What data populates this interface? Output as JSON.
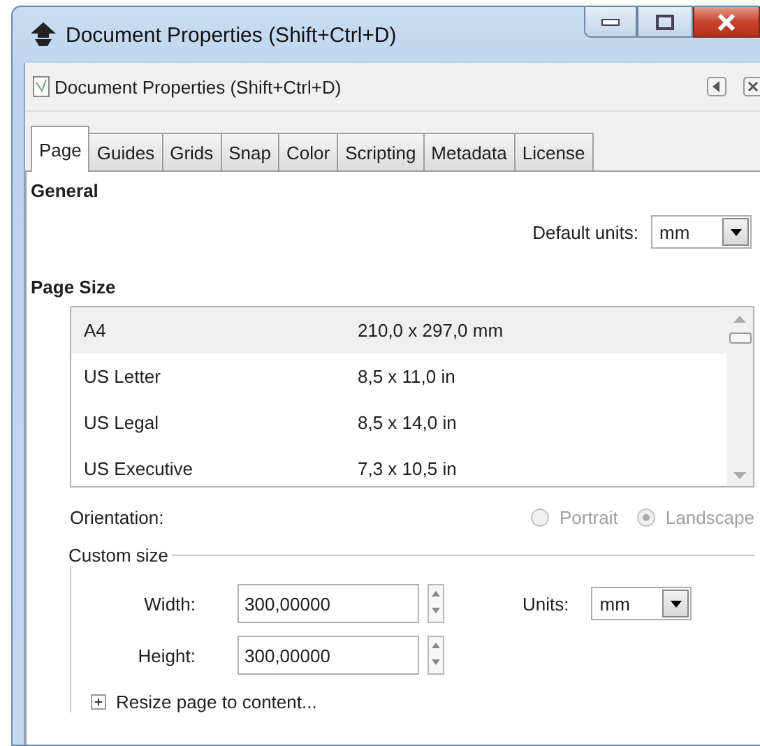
{
  "window": {
    "title": "Document Properties (Shift+Ctrl+D)"
  },
  "panel": {
    "title": "Document Properties (Shift+Ctrl+D)"
  },
  "tabs": [
    {
      "label": "Page",
      "selected": true
    },
    {
      "label": "Guides",
      "selected": false
    },
    {
      "label": "Grids",
      "selected": false
    },
    {
      "label": "Snap",
      "selected": false
    },
    {
      "label": "Color",
      "selected": false
    },
    {
      "label": "Scripting",
      "selected": false
    },
    {
      "label": "Metadata",
      "selected": false
    },
    {
      "label": "License",
      "selected": false
    }
  ],
  "general": {
    "heading": "General",
    "default_units": {
      "label": "Default units:",
      "value": "mm"
    }
  },
  "page_size": {
    "heading": "Page Size",
    "rows": [
      {
        "name": "A4",
        "size": "210,0 x 297,0 mm",
        "selected": true
      },
      {
        "name": "US Letter",
        "size": "8,5 x 11,0 in",
        "selected": false
      },
      {
        "name": "US Legal",
        "size": "8,5 x 14,0 in",
        "selected": false
      },
      {
        "name": "US Executive",
        "size": "7,3 x 10,5 in",
        "selected": false
      }
    ]
  },
  "orientation": {
    "label": "Orientation:",
    "disabled": true,
    "options": [
      {
        "label": "Portrait",
        "selected": false
      },
      {
        "label": "Landscape",
        "selected": true
      }
    ]
  },
  "custom_size": {
    "legend": "Custom size",
    "width": {
      "label": "Width:",
      "value": "300,00000"
    },
    "height": {
      "label": "Height:",
      "value": "300,00000"
    },
    "units": {
      "label": "Units:",
      "value": "mm"
    },
    "resize": {
      "label": "Resize page to content...",
      "expanded": false
    }
  }
}
